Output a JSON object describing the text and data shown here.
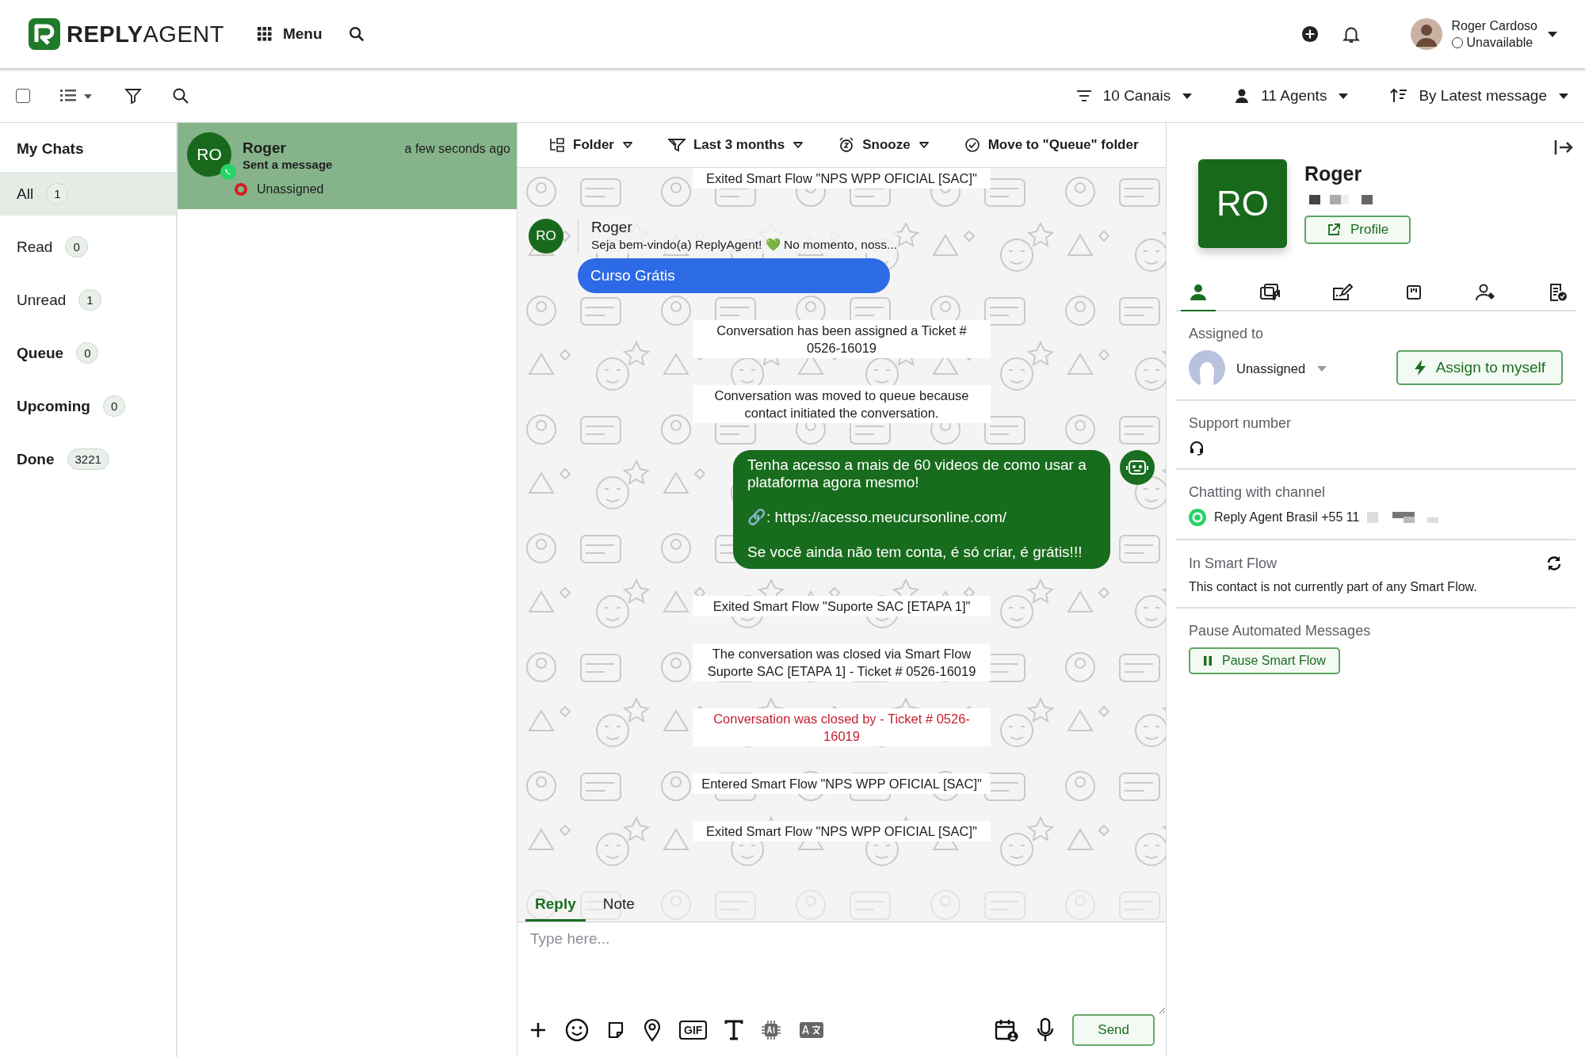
{
  "header": {
    "brand": {
      "prefix": "REPLY",
      "suffix": "AGENT"
    },
    "menu_label": "Menu",
    "user": {
      "name": "Roger Cardoso",
      "status": "Unavailable"
    }
  },
  "toolbar": {
    "select_all": {
      "checked": false
    },
    "filters": [
      {
        "label": "10 Canais",
        "kind": "filter"
      },
      {
        "label": "11 Agents",
        "kind": "agent"
      },
      {
        "label": "By Latest message",
        "kind": "sort"
      }
    ]
  },
  "folders": {
    "title": "My Chats",
    "items": [
      {
        "label": "All",
        "count": "1",
        "selected": true,
        "bold": false
      },
      {
        "label": "Read",
        "count": "0",
        "selected": false,
        "bold": false
      },
      {
        "label": "Unread",
        "count": "1",
        "selected": false,
        "bold": false
      },
      {
        "label": "Queue",
        "count": "0",
        "selected": false,
        "bold": true
      },
      {
        "label": "Upcoming",
        "count": "0",
        "selected": false,
        "bold": true
      },
      {
        "label": "Done",
        "count": "3221",
        "selected": false,
        "bold": true
      }
    ]
  },
  "chats": [
    {
      "initials": "RO",
      "name": "Roger",
      "preview": "Sent a message",
      "time": "a few seconds ago",
      "assignee": "Unassigned",
      "selected": true
    }
  ],
  "conversation": {
    "actions": [
      {
        "label": "Folder",
        "kind": "folder"
      },
      {
        "label": "Last 3 months",
        "kind": "period"
      },
      {
        "label": "Snooze",
        "kind": "snooze"
      },
      {
        "label": "Move to \"Queue\" folder",
        "kind": "move"
      }
    ],
    "messages": [
      {
        "kind": "system",
        "text": "Exited Smart Flow \"NPS WPP OFICIAL [SAC]\""
      },
      {
        "kind": "incoming",
        "initials": "RO",
        "author": "Roger",
        "text": "Seja bem-vindo(a) ReplyAgent! 💚 No momento, noss..."
      },
      {
        "kind": "button",
        "text": "Curso Grátis"
      },
      {
        "kind": "system",
        "text": "Conversation has been assigned a Ticket # 0526-16019"
      },
      {
        "kind": "system",
        "text": "Conversation was moved to queue because contact initiated the conversation."
      },
      {
        "kind": "outgoing",
        "paragraphs": [
          "Tenha acesso a mais de 60 videos de como usar a plataforma agora mesmo!",
          "🔗: https://acesso.meucursonline.com/",
          "Se você ainda não tem conta, é só criar, é grátis!!!"
        ]
      },
      {
        "kind": "system",
        "text": "Exited Smart Flow \"Suporte SAC [ETAPA 1]\""
      },
      {
        "kind": "system",
        "text": "The conversation was closed via Smart Flow Suporte SAC [ETAPA 1] - Ticket # 0526-16019"
      },
      {
        "kind": "alert",
        "text": "Conversation was closed by - Ticket # 0526-16019"
      },
      {
        "kind": "system",
        "text": "Entered Smart Flow \"NPS WPP OFICIAL [SAC]\""
      },
      {
        "kind": "system",
        "text": "Exited Smart Flow \"NPS WPP OFICIAL [SAC]\""
      }
    ],
    "compose": {
      "gif_label": "GIF",
      "tabs": [
        {
          "label": "Reply",
          "selected": true
        },
        {
          "label": "Note",
          "selected": false
        }
      ],
      "placeholder": "Type here...",
      "send": "Send"
    }
  },
  "contact": {
    "initials": "RO",
    "name": "Roger",
    "profile_button": "Profile",
    "tabs": [
      {
        "selected": true
      },
      {
        "selected": false
      },
      {
        "selected": false
      },
      {
        "selected": false
      },
      {
        "selected": false
      },
      {
        "selected": false
      }
    ],
    "assigned": {
      "title": "Assigned to",
      "value": "Unassigned",
      "action": "Assign to myself"
    },
    "support": {
      "title": "Support number"
    },
    "channel": {
      "title": "Chatting with channel",
      "value": "Reply Agent Brasil +55 11"
    },
    "smart_flow": {
      "title": "In Smart Flow",
      "text": "This contact is not currently part of any Smart Flow."
    },
    "pause": {
      "title": "Pause Automated Messages",
      "action": "Pause Smart Flow"
    }
  }
}
